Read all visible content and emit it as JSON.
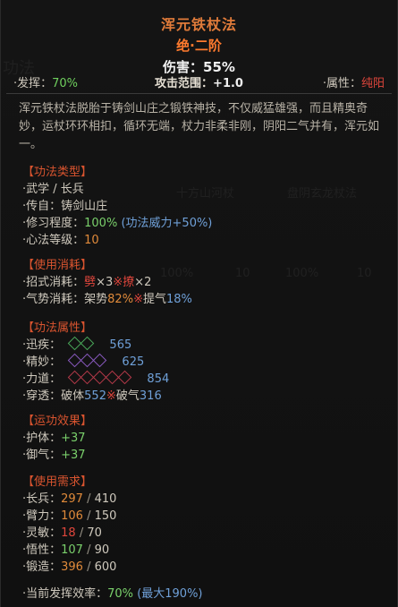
{
  "skill": {
    "name": "浑元铁杖法",
    "grade": "绝·二阶",
    "damage_label": "伤害：",
    "damage_value": "55%"
  },
  "statline": {
    "fahui_label": "·发挥：",
    "fahui_value": "70%",
    "range_label": "攻击范围：",
    "range_value": "+1.0",
    "attr_label": "·属性：",
    "attr_value": "纯阳"
  },
  "description": "浑元铁杖法脱胎于铸剑山庄之锻铁神技，不仅威猛雄强，而且精奥奇妙，运杖环环相扣，循环无端，杖力非柔非刚，阴阳二气并有，浑元如一。",
  "type_section": {
    "title": "【功法类型】",
    "rows": [
      {
        "label": "·武学 / 长兵"
      },
      {
        "label": "·传自：",
        "value": "铸剑山庄"
      },
      {
        "label": "·修习程度：",
        "value": "100%",
        "extra": "(功法威力+50%)"
      },
      {
        "label": "·心法等级：",
        "value": "10"
      }
    ]
  },
  "cost_section": {
    "title": "【使用消耗】",
    "move_label": "·招式消耗：",
    "move_a": "劈",
    "move_a_count": "×3",
    "sep": "※",
    "move_b": "撩",
    "move_b_count": "×2",
    "qi_label": "·气势消耗：",
    "qi_a": "架势",
    "qi_a_val": "82%",
    "qi_b": "提气",
    "qi_b_val": "18%"
  },
  "attr_section": {
    "title": "【功法属性】",
    "rows": [
      {
        "label": "·迅疾：",
        "value": "565"
      },
      {
        "label": "·精妙：",
        "value": "625"
      },
      {
        "label": "·力道：",
        "value": "854"
      }
    ],
    "pierce_label": "·穿透：",
    "pierce_a": "破体",
    "pierce_a_val": "552",
    "pierce_sep": "※",
    "pierce_b": "破气",
    "pierce_b_val": "316"
  },
  "effect_section": {
    "title": "【运功效果】",
    "rows": [
      {
        "label": "·护体：",
        "value": "+37"
      },
      {
        "label": "·御气：",
        "value": "+37"
      }
    ]
  },
  "req_section": {
    "title": "【使用需求】",
    "rows": [
      {
        "label": "·长兵：",
        "cur": "297",
        "max": "410"
      },
      {
        "label": "·臂力：",
        "cur": "106",
        "max": "150"
      },
      {
        "label": "·灵敏：",
        "cur": "18",
        "max": "70"
      },
      {
        "label": "·悟性：",
        "cur": "107",
        "max": "90"
      },
      {
        "label": "·锻造：",
        "cur": "396",
        "max": "600"
      }
    ]
  },
  "efficiency": {
    "label": "·当前发挥效率：",
    "value": "70%",
    "max": "(最大190%)"
  },
  "background_ghost": {
    "left_label": "功法",
    "col1": "十方山河杖",
    "col2": "盘阴玄龙杖法",
    "num1": "100%",
    "num2": "10",
    "num3": "100%",
    "num4": "10"
  },
  "colors": {
    "title_orange": "#e07b3a",
    "section_red": "#d9542f",
    "value_green": "#7ad06b",
    "value_blue": "#6fa0d8",
    "value_red": "#e0463c",
    "value_orange": "#e08a3a"
  }
}
